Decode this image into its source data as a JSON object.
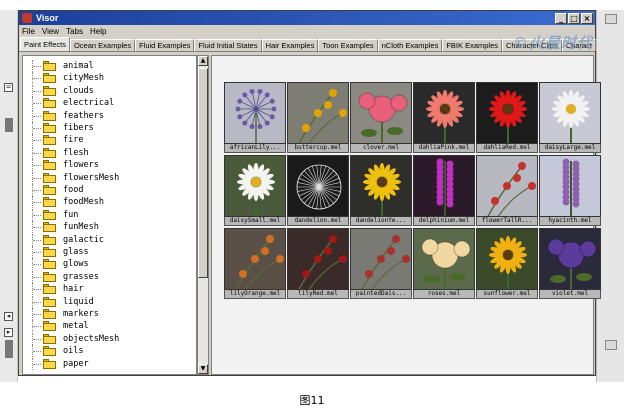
{
  "window": {
    "title": "Visor",
    "controls": [
      "_",
      "□",
      "×"
    ]
  },
  "menu": [
    "File",
    "View",
    "Tabs",
    "Help"
  ],
  "tabs": [
    {
      "label": "Paint Effects",
      "active": true
    },
    {
      "label": "Ocean Examples",
      "active": false
    },
    {
      "label": "Fluid Examples",
      "active": false
    },
    {
      "label": "Fluid Initial States",
      "active": false
    },
    {
      "label": "Hair Examples",
      "active": false
    },
    {
      "label": "Toon Examples",
      "active": false
    },
    {
      "label": "nCloth Examples",
      "active": false
    },
    {
      "label": "FBIK Examples",
      "active": false
    },
    {
      "label": "Character Clips",
      "active": false
    },
    {
      "label": "Charact",
      "active": false
    }
  ],
  "watermark": "©火星时代",
  "tree": {
    "items": [
      "animal",
      "cityMesh",
      "clouds",
      "electrical",
      "feathers",
      "fibers",
      "fire",
      "flesh",
      "flowers",
      "flowersMesh",
      "food",
      "foodMesh",
      "fun",
      "funMesh",
      "galactic",
      "glass",
      "glows",
      "grasses",
      "hair",
      "liquid",
      "markers",
      "metal",
      "objectsMesh",
      "oils",
      "paper"
    ]
  },
  "thumbnails": [
    {
      "caption": "africanLily...",
      "bg": "#b9b9c6",
      "flower": "#6a5aa8",
      "type": "burst"
    },
    {
      "caption": "buttercup.mel",
      "bg": "#7d7d73",
      "flower": "#e0a500",
      "type": "sprig"
    },
    {
      "caption": "clover.mel",
      "bg": "#8a8a82",
      "flower": "#e8607a",
      "type": "ball"
    },
    {
      "caption": "dahliaPink.mel",
      "bg": "#2a2a2a",
      "flower": "#f07a6e",
      "type": "daisy"
    },
    {
      "caption": "dahliaRed.mel",
      "bg": "#1c1c1c",
      "flower": "#e01818",
      "type": "daisy"
    },
    {
      "caption": "daisyLarge.mel",
      "bg": "#c9c9d6",
      "flower": "#f2f2f2",
      "type": "daisy2"
    },
    {
      "caption": "daisySmall.mel",
      "bg": "#4a5a3a",
      "flower": "#f5f5f0",
      "type": "daisy2"
    },
    {
      "caption": "dandelion.mel",
      "bg": "#1a1a1a",
      "flower": "#e6e6e6",
      "type": "puff"
    },
    {
      "caption": "dandelionYe...",
      "bg": "#2e2e2a",
      "flower": "#f0c010",
      "type": "daisy"
    },
    {
      "caption": "delphinium.mel",
      "bg": "#2a1a2a",
      "flower": "#c030c0",
      "type": "spike"
    },
    {
      "caption": "flowerTallR...",
      "bg": "#b8b8c0",
      "flower": "#c83030",
      "type": "sprig"
    },
    {
      "caption": "hyacinth.mel",
      "bg": "#c4c8d8",
      "flower": "#9060b0",
      "type": "spike"
    },
    {
      "caption": "lilyOrange.mel",
      "bg": "#5a5048",
      "flower": "#d07020",
      "type": "sprig"
    },
    {
      "caption": "lilyRed.mel",
      "bg": "#3a2a2a",
      "flower": "#a01818",
      "type": "sprig"
    },
    {
      "caption": "paintedDais...",
      "bg": "#7a7a74",
      "flower": "#a83030",
      "type": "sprig"
    },
    {
      "caption": "roses.mel",
      "bg": "#5a6a4a",
      "flower": "#f0d8a0",
      "type": "ball"
    },
    {
      "caption": "sunflower.mel",
      "bg": "#3a4a2a",
      "flower": "#f0b010",
      "type": "daisy"
    },
    {
      "caption": "violet.mel",
      "bg": "#2a2a3a",
      "flower": "#5a3a9a",
      "type": "ball"
    }
  ],
  "figure_caption": "图11"
}
